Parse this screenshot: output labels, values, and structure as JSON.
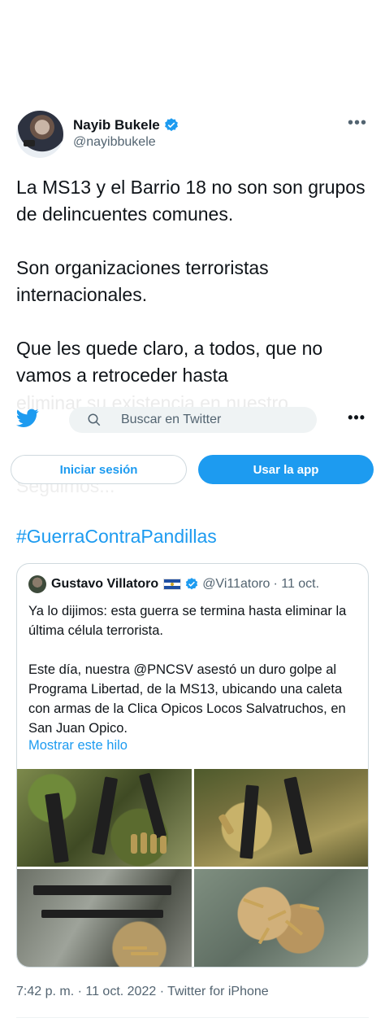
{
  "tweet": {
    "author_name": "Nayib Bukele",
    "author_handle": "@nayibbukele",
    "more_label": "•••",
    "paragraphs": [
      "La MS13 y el Barrio 18 no son son grupos de delincuentes comunes.",
      "Son organizaciones terroristas internacionales.",
      "Que les quede claro, a todos, que no vamos a retroceder hasta"
    ],
    "faded_line": "eliminar su existencia en nuestro",
    "faded_line_2": "Seguimos...",
    "hashtag": "#GuerraContraPandillas",
    "footer": "7:42 p. m. · 11 oct. 2022 · Twitter for iPhone"
  },
  "topbar": {
    "search_placeholder": "Buscar en Twitter",
    "more_label": "•••"
  },
  "actions": {
    "login_label": "Iniciar sesión",
    "app_label": "Usar la app"
  },
  "quote": {
    "author_name": "Gustavo Villatoro",
    "author_handle": "@Vi11atoro",
    "date": "· 11 oct.",
    "paragraphs": [
      "Ya lo dijimos: esta guerra se termina hasta eliminar la última célula terrorista.",
      "Este día, nuestra @PNCSV asestó un duro golpe al Programa Libertad, de la MS13, ubicando una caleta con armas de la Clica Opicos Locos Salvatruchos, en San Juan Opico."
    ],
    "show_thread": "Mostrar este hilo"
  },
  "colors": {
    "accent": "#1d9bf0",
    "text": "#0f1419",
    "muted": "#536471"
  }
}
